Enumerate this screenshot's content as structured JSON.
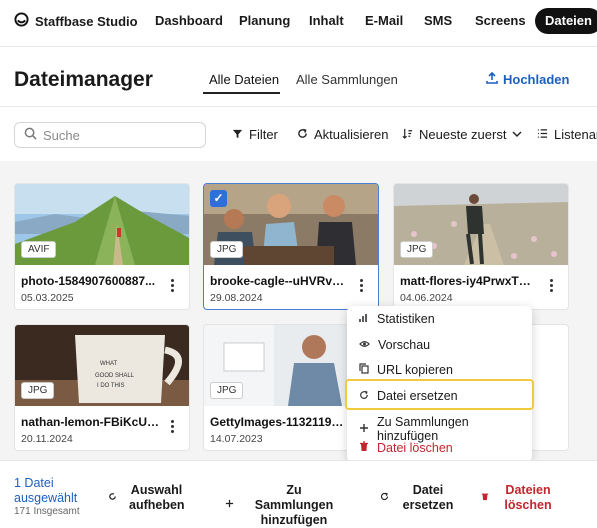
{
  "brand": {
    "name": "Staffbase Studio",
    "icon": "staffbase-logo-icon"
  },
  "nav": {
    "items": [
      {
        "label": "Dashboard"
      },
      {
        "label": "Planung"
      },
      {
        "label": "Inhalt"
      },
      {
        "label": "E-Mail"
      },
      {
        "label": "SMS"
      },
      {
        "label": "Screens"
      },
      {
        "label": "Dateien",
        "active": true
      }
    ]
  },
  "page": {
    "title": "Dateimanager",
    "tabs": [
      {
        "label": "Alle Dateien",
        "active": true
      },
      {
        "label": "Alle Sammlungen"
      }
    ],
    "upload_label": "Hochladen"
  },
  "toolbar": {
    "search_placeholder": "Suche",
    "filter_label": "Filter",
    "refresh_label": "Aktualisieren",
    "sort_label": "Neueste zuerst",
    "view_label": "Listenan"
  },
  "files": [
    {
      "name": "photo-1584907600887...",
      "date": "05.03.2025",
      "type": "AVIF",
      "selected": false
    },
    {
      "name": "brooke-cagle--uHVRvD...",
      "date": "29.08.2024",
      "type": "JPG",
      "selected": true
    },
    {
      "name": "matt-flores-iy4PrwxTni...",
      "date": "04.06.2024",
      "type": "JPG",
      "selected": false
    },
    {
      "name": "nathan-lemon-FBiKcUw...",
      "date": "20.11.2024",
      "type": "JPG",
      "selected": false
    },
    {
      "name": "GettyImages-1132119294...",
      "date": "14.07.2023",
      "type": "JPG",
      "selected": false
    }
  ],
  "context_menu": {
    "items": [
      {
        "label": "Statistiken",
        "icon": "bar-chart-icon"
      },
      {
        "label": "Vorschau",
        "icon": "eye-icon"
      },
      {
        "label": "URL kopieren",
        "icon": "copy-icon"
      },
      {
        "label": "Datei ersetzen",
        "icon": "refresh-icon",
        "highlighted": true
      },
      {
        "label": "Zu Sammlungen hinzufügen",
        "icon": "plus-icon"
      },
      {
        "label": "Datei löschen",
        "icon": "trash-icon",
        "danger": true
      }
    ]
  },
  "bottom_bar": {
    "selected_text": "1 Datei ausgewählt",
    "total_text": "171 Insgesamt",
    "actions": [
      {
        "label": "Auswahl aufheben",
        "icon": "undo-icon"
      },
      {
        "label": "Zu Sammlungen hinzufügen",
        "icon": "plus-icon"
      },
      {
        "label": "Datei ersetzen",
        "icon": "refresh-icon"
      },
      {
        "label": "Dateien löschen",
        "icon": "trash-icon",
        "danger": true
      }
    ]
  },
  "colors": {
    "accent": "#1c5fbf",
    "danger": "#c0262d",
    "highlight": "#f2c93c",
    "selection": "#2f6fd8"
  }
}
